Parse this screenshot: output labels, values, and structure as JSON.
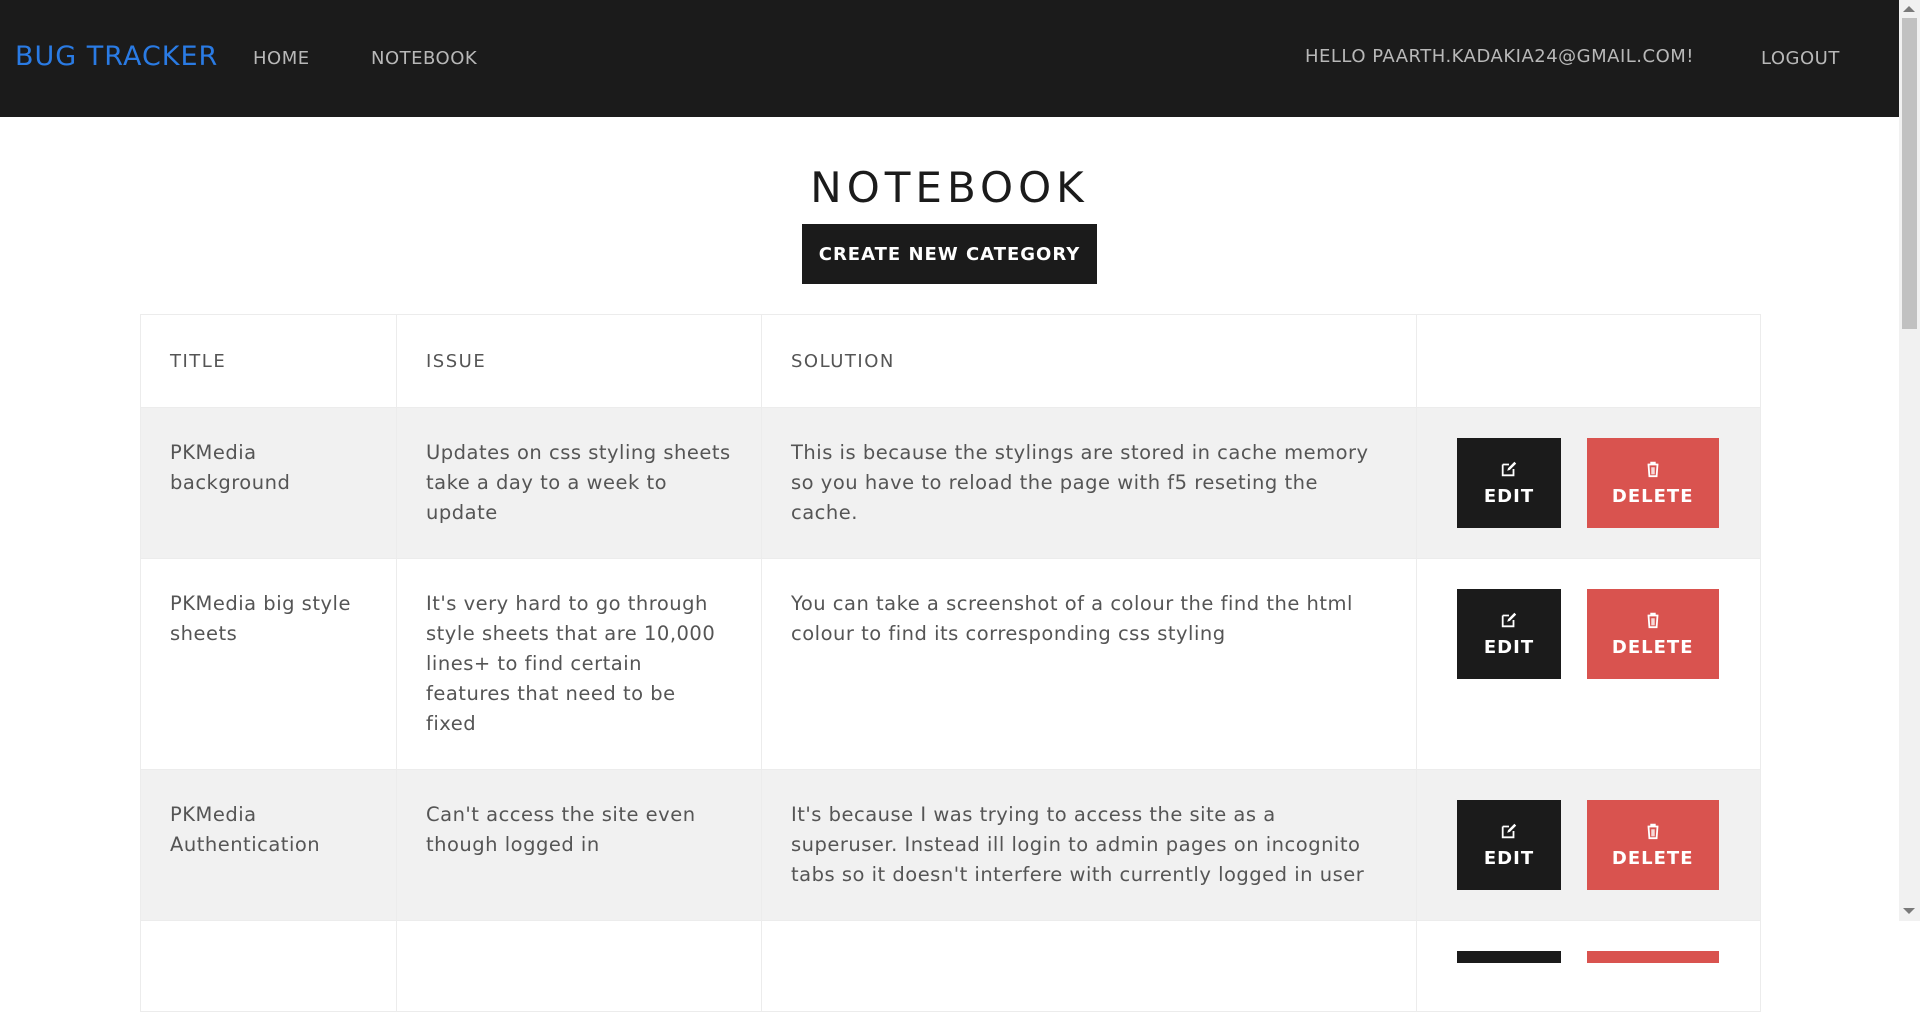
{
  "navbar": {
    "brand": "BUG TRACKER",
    "links": [
      {
        "label": "HOME"
      },
      {
        "label": "NOTEBOOK"
      }
    ],
    "greeting": "HELLO PAARTH.KADAKIA24@GMAIL.COM!",
    "logout_label": "LOGOUT"
  },
  "page": {
    "title": "NOTEBOOK",
    "create_button_label": "CREATE NEW CATEGORY"
  },
  "table": {
    "headers": [
      "TITLE",
      "ISSUE",
      "SOLUTION",
      ""
    ],
    "rows": [
      {
        "title": "PKMedia background",
        "issue": "Updates on css styling sheets take a day to a week to update",
        "solution": "This is because the stylings are stored in cache memory so you have to reload the page with f5 reseting the cache.",
        "edit_label": "EDIT",
        "delete_label": "DELETE"
      },
      {
        "title": "PKMedia big style sheets",
        "issue": "It's very hard to go through style sheets that are 10,000 lines+ to find certain features that need to be fixed",
        "solution": "You can take a screenshot of a colour the find the html colour to find its corresponding css styling",
        "edit_label": "EDIT",
        "delete_label": "DELETE"
      },
      {
        "title": "PKMedia Authentication",
        "issue": "Can't access the site even though logged in",
        "solution": "It's because I was trying to access the site as a superuser. Instead ill login to admin pages on incognito tabs so it doesn't interfere with currently logged in user",
        "edit_label": "EDIT",
        "delete_label": "DELETE"
      }
    ]
  },
  "icons": {
    "edit": "edit-icon",
    "delete": "trash-icon"
  },
  "colors": {
    "navbar_bg": "#1b1b1b",
    "brand": "#2a7be4",
    "delete_button": "#d9534f",
    "row_stripe": "#f1f1f1"
  }
}
